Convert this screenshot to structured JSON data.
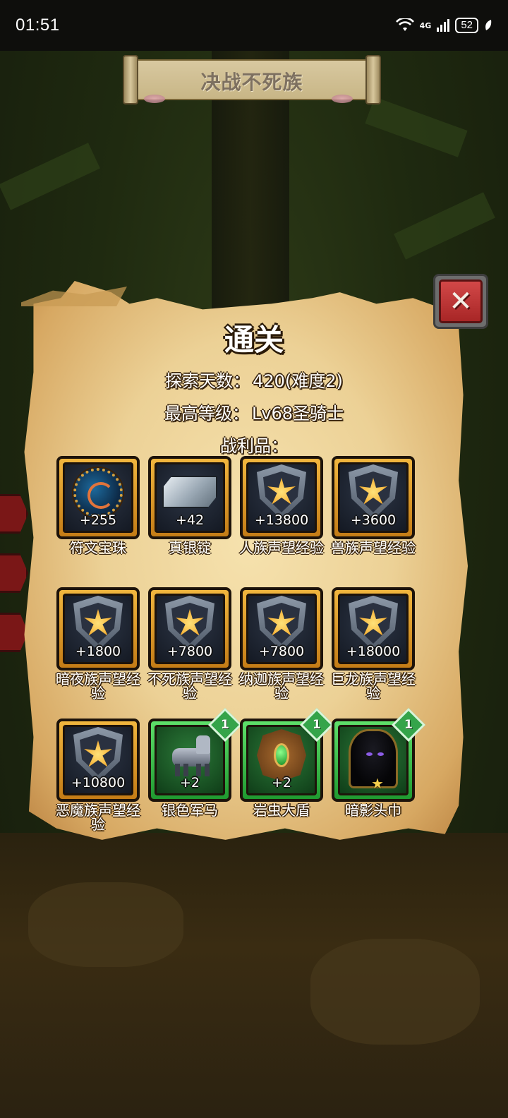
{
  "status_bar": {
    "time": "01:51",
    "network": "4G",
    "battery": "52"
  },
  "banner": {
    "title": "决战不死族"
  },
  "result": {
    "title": "通关",
    "explore_label": "探索天数：",
    "explore_value": "420(难度2)",
    "level_label": "最高等级：",
    "level_value": "Lv68圣骑士",
    "loot_label": "战利品："
  },
  "colors": {
    "parchment": "#ecd196",
    "frame_gold": "#e0a030",
    "frame_green": "#3fbf4d",
    "close_red": "#c23a3a"
  },
  "rewards": [
    {
      "name": "符文宝珠",
      "qty": "+255",
      "icon": "rune-orb-icon",
      "frame": "gold"
    },
    {
      "name": "真银锭",
      "qty": "+42",
      "icon": "silver-ingot-icon",
      "frame": "gold"
    },
    {
      "name": "人族声望经验",
      "qty": "+13800",
      "icon": "reputation-shield-icon",
      "frame": "gold"
    },
    {
      "name": "兽族声望经验",
      "qty": "+3600",
      "icon": "reputation-shield-icon",
      "frame": "gold"
    },
    {
      "name": "暗夜族声望经验",
      "qty": "+1800",
      "icon": "reputation-shield-icon",
      "frame": "gold"
    },
    {
      "name": "不死族声望经验",
      "qty": "+7800",
      "icon": "reputation-shield-icon",
      "frame": "gold"
    },
    {
      "name": "纳迦族声望经验",
      "qty": "+7800",
      "icon": "reputation-shield-icon",
      "frame": "gold"
    },
    {
      "name": "巨龙族声望经验",
      "qty": "+18000",
      "icon": "reputation-shield-icon",
      "frame": "gold"
    },
    {
      "name": "恶魔族声望经验",
      "qty": "+10800",
      "icon": "reputation-shield-icon",
      "frame": "gold"
    },
    {
      "name": "银色军马",
      "qty": "+2",
      "icon": "silver-warhorse-icon",
      "frame": "green",
      "badge": "1"
    },
    {
      "name": "岩虫大盾",
      "qty": "+2",
      "icon": "rockworm-shield-icon",
      "frame": "green",
      "badge": "1"
    },
    {
      "name": "暗影头巾",
      "qty": "",
      "icon": "shadow-hood-icon",
      "frame": "green",
      "badge": "1",
      "star": "★"
    }
  ]
}
